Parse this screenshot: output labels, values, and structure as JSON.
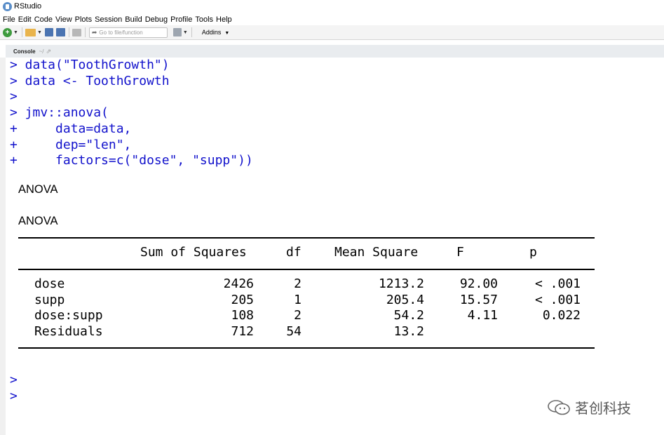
{
  "app": {
    "title": "RStudio"
  },
  "menu": [
    "File",
    "Edit",
    "Code",
    "View",
    "Plots",
    "Session",
    "Build",
    "Debug",
    "Profile",
    "Tools",
    "Help"
  ],
  "toolbar": {
    "goto_placeholder": "Go to file/function",
    "addins_label": "Addins"
  },
  "console": {
    "tab_label": "Console",
    "path": "~/",
    "input_lines": [
      "> data(\"ToothGrowth\")",
      "> data <- ToothGrowth",
      ">",
      "> jmv::anova(",
      "+     data=data,",
      "+     dep=\"len\",",
      "+     factors=c(\"dose\", \"supp\"))"
    ],
    "output_title_1": "ANOVA",
    "output_title_2": "ANOVA",
    "table": {
      "headers": [
        "Sum of Squares",
        "df",
        "Mean Square",
        "F",
        "p"
      ],
      "rows": [
        {
          "term": "dose",
          "ss": "2426",
          "df": "2",
          "ms": "1213.2",
          "f": "92.00",
          "p": "< .001"
        },
        {
          "term": "supp",
          "ss": "205",
          "df": "1",
          "ms": "205.4",
          "f": "15.57",
          "p": "< .001"
        },
        {
          "term": "dose:supp",
          "ss": "108",
          "df": "2",
          "ms": "54.2",
          "f": "4.11",
          "p": "0.022"
        },
        {
          "term": "Residuals",
          "ss": "712",
          "df": "54",
          "ms": "13.2",
          "f": "",
          "p": ""
        }
      ]
    },
    "trailing_prompts": [
      ">",
      ">"
    ]
  },
  "watermark": {
    "text": "茗创科技"
  },
  "colors": {
    "code": "#1212cc",
    "output": "#000000",
    "toolbar_bg": "#f4f4f4"
  }
}
